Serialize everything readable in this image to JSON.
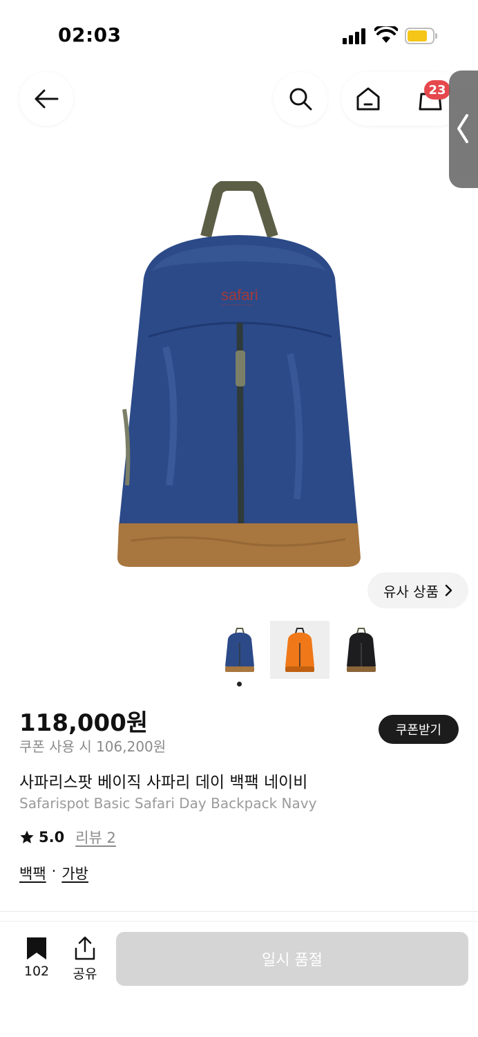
{
  "status_bar": {
    "time": "02:03"
  },
  "nav": {
    "cart_count": "23"
  },
  "similar_products": {
    "label": "유사 상품"
  },
  "thumbnails": [
    {
      "color": "navy"
    },
    {
      "color": "orange"
    },
    {
      "color": "black"
    }
  ],
  "product": {
    "price": "118,000원",
    "coupon_price": "쿠폰 사용 시 106,200원",
    "coupon_button": "쿠폰받기",
    "title_ko": "사파리스팟 베이직 사파리 데이 백팩 네이비",
    "title_en": "Safarispot Basic Safari Day Backpack Navy",
    "rating": "5.0",
    "review_link": "리뷰 2",
    "tags": [
      "백팩",
      "가방"
    ],
    "tag_separator": "·",
    "image_brand_text": "safari"
  },
  "bottom_bar": {
    "bookmark_count": "102",
    "share_label": "공유",
    "soldout_label": "일시 품절"
  },
  "colors": {
    "badge": "#e5484d",
    "navy": "#2c4a88",
    "brown": "#a8763f",
    "strap": "#5c5f46",
    "soldout": "#d5d5d5"
  }
}
